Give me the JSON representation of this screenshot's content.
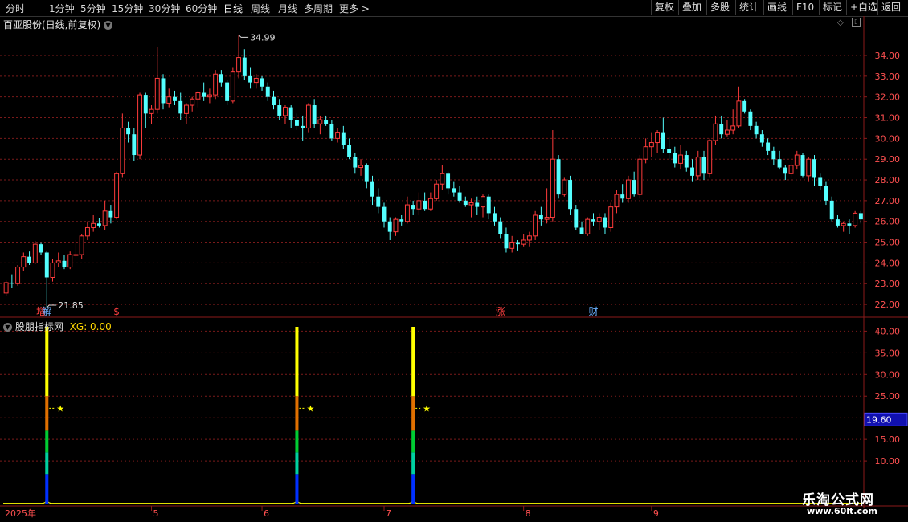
{
  "toolbar": {
    "periods": [
      "分时",
      "1分钟",
      "5分钟",
      "15分钟",
      "30分钟",
      "60分钟",
      "日线",
      "周线",
      "月线",
      "多周期",
      "更多"
    ],
    "active_period": "日线",
    "right_buttons": [
      "复权",
      "叠加",
      "多股",
      "统计",
      "画线",
      "F10",
      "标记",
      "+自选",
      "返回"
    ]
  },
  "main_panel": {
    "title": "百亚股份(日线,前复权)",
    "high_label": "34.99",
    "low_label": "21.85",
    "event_markers": [
      {
        "label": "增",
        "color": "#ff4040",
        "index": 6
      },
      {
        "label": "解",
        "color": "#6ab0ff",
        "index": 7
      },
      {
        "label": "$",
        "color": "#ff4040",
        "index": 19
      },
      {
        "label": "涨",
        "color": "#ff4040",
        "index": 85
      },
      {
        "label": "财",
        "color": "#6ab0ff",
        "index": 101
      }
    ],
    "y_ticks": [
      "34.00",
      "33.00",
      "32.00",
      "31.00",
      "30.00",
      "29.00",
      "28.00",
      "27.00",
      "26.00",
      "25.00",
      "24.00",
      "23.00",
      "22.00"
    ]
  },
  "indicator_panel": {
    "title": "股朋指标网",
    "value_label": "XG: 0.00",
    "y_ticks": [
      "40.00",
      "35.00",
      "30.00",
      "25.00",
      "20.00",
      "15.00",
      "10.00"
    ],
    "current_value": "19.60",
    "signal_symbol": "★"
  },
  "x_axis": {
    "labels": [
      {
        "text": "2025年",
        "index": 0
      },
      {
        "text": "5",
        "index": 25
      },
      {
        "text": "6",
        "index": 44
      },
      {
        "text": "7",
        "index": 65
      },
      {
        "text": "8",
        "index": 89
      },
      {
        "text": "9",
        "index": 111
      }
    ]
  },
  "watermark": {
    "title": "乐淘公式网",
    "url": "www.60lt.com"
  },
  "colors": {
    "up": "#ff3b3b",
    "down": "#54ffff",
    "grid": "#7a1a1a",
    "signal_yellow": "#ffff00",
    "signal_orange": "#e07000",
    "signal_green": "#00cc33",
    "signal_blue": "#0030ff"
  },
  "chart_data": {
    "type": "candlestick",
    "x": "trading days (2025年 Apr–Sep)",
    "ohlc": [
      [
        22.55,
        23.15,
        22.4,
        23.05
      ],
      [
        23.05,
        23.45,
        22.8,
        23.0
      ],
      [
        23.0,
        23.9,
        22.9,
        23.8
      ],
      [
        23.8,
        24.5,
        23.6,
        24.3
      ],
      [
        24.3,
        24.55,
        23.9,
        24.0
      ],
      [
        24.0,
        25.05,
        23.95,
        24.9
      ],
      [
        24.9,
        25.0,
        24.4,
        24.5
      ],
      [
        24.5,
        24.6,
        21.85,
        23.3
      ],
      [
        23.3,
        24.2,
        23.1,
        24.0
      ],
      [
        24.0,
        24.5,
        23.8,
        24.1
      ],
      [
        24.1,
        24.4,
        23.7,
        23.8
      ],
      [
        23.8,
        24.55,
        23.7,
        24.4
      ],
      [
        24.4,
        25.1,
        24.3,
        24.4
      ],
      [
        24.4,
        25.4,
        24.2,
        25.3
      ],
      [
        25.3,
        26.0,
        25.1,
        25.7
      ],
      [
        25.7,
        26.3,
        25.5,
        25.9
      ],
      [
        25.9,
        26.15,
        25.7,
        25.8
      ],
      [
        25.8,
        27.0,
        25.6,
        26.5
      ],
      [
        26.5,
        26.8,
        25.9,
        26.2
      ],
      [
        26.2,
        28.4,
        26.1,
        28.3
      ],
      [
        28.3,
        31.2,
        28.1,
        30.5
      ],
      [
        30.5,
        30.8,
        29.8,
        30.2
      ],
      [
        30.2,
        30.5,
        28.9,
        29.2
      ],
      [
        29.2,
        32.2,
        29.0,
        32.1
      ],
      [
        32.1,
        32.2,
        30.5,
        31.2
      ],
      [
        31.2,
        31.6,
        30.7,
        31.4
      ],
      [
        31.4,
        34.4,
        31.2,
        32.9
      ],
      [
        32.9,
        33.1,
        31.4,
        31.7
      ],
      [
        31.7,
        32.4,
        31.5,
        32.0
      ],
      [
        32.0,
        32.3,
        31.6,
        31.8
      ],
      [
        31.8,
        32.2,
        30.9,
        31.2
      ],
      [
        31.2,
        31.7,
        30.7,
        31.6
      ],
      [
        31.6,
        32.0,
        31.3,
        31.9
      ],
      [
        31.9,
        32.3,
        31.5,
        32.2
      ],
      [
        32.2,
        32.7,
        31.8,
        32.0
      ],
      [
        32.0,
        32.4,
        31.7,
        32.1
      ],
      [
        32.1,
        33.3,
        31.9,
        33.1
      ],
      [
        33.1,
        33.3,
        32.5,
        32.7
      ],
      [
        32.7,
        32.8,
        31.6,
        31.8
      ],
      [
        31.8,
        33.4,
        31.7,
        33.2
      ],
      [
        33.2,
        34.99,
        32.9,
        33.9
      ],
      [
        33.9,
        34.3,
        32.8,
        33.0
      ],
      [
        33.0,
        33.4,
        32.4,
        32.7
      ],
      [
        32.7,
        33.1,
        32.4,
        32.9
      ],
      [
        32.9,
        33.0,
        32.3,
        32.5
      ],
      [
        32.5,
        32.7,
        31.8,
        32.0
      ],
      [
        32.0,
        32.3,
        31.4,
        31.6
      ],
      [
        31.6,
        31.9,
        30.9,
        31.1
      ],
      [
        31.1,
        31.6,
        30.7,
        31.5
      ],
      [
        31.5,
        31.6,
        30.5,
        30.9
      ],
      [
        30.9,
        31.2,
        30.4,
        30.6
      ],
      [
        30.6,
        31.1,
        29.9,
        30.5
      ],
      [
        30.5,
        31.7,
        30.3,
        31.6
      ],
      [
        31.6,
        31.9,
        30.5,
        30.7
      ],
      [
        30.7,
        31.1,
        30.2,
        30.9
      ],
      [
        30.9,
        31.1,
        30.6,
        30.7
      ],
      [
        30.7,
        30.9,
        29.9,
        30.0
      ],
      [
        30.0,
        30.5,
        29.8,
        30.3
      ],
      [
        30.3,
        30.6,
        29.5,
        29.7
      ],
      [
        29.7,
        30.0,
        29.0,
        29.1
      ],
      [
        29.1,
        29.3,
        28.3,
        28.6
      ],
      [
        28.6,
        29.0,
        28.2,
        28.7
      ],
      [
        28.7,
        28.8,
        27.6,
        27.9
      ],
      [
        27.9,
        28.2,
        26.8,
        27.2
      ],
      [
        27.2,
        27.6,
        26.4,
        26.7
      ],
      [
        26.7,
        26.9,
        25.7,
        26.0
      ],
      [
        26.0,
        26.2,
        25.1,
        25.5
      ],
      [
        25.5,
        26.2,
        25.3,
        26.1
      ],
      [
        26.1,
        26.3,
        25.8,
        26.0
      ],
      [
        26.0,
        27.2,
        25.9,
        26.8
      ],
      [
        26.8,
        27.0,
        26.3,
        26.6
      ],
      [
        26.6,
        27.4,
        26.3,
        27.0
      ],
      [
        27.0,
        27.4,
        26.5,
        26.6
      ],
      [
        26.6,
        27.4,
        26.5,
        27.1
      ],
      [
        27.1,
        28.0,
        27.0,
        27.8
      ],
      [
        27.8,
        28.7,
        27.5,
        28.3
      ],
      [
        28.3,
        28.4,
        27.3,
        27.6
      ],
      [
        27.6,
        27.9,
        27.2,
        27.4
      ],
      [
        27.4,
        27.7,
        26.9,
        27.0
      ],
      [
        27.0,
        27.2,
        26.7,
        26.8
      ],
      [
        26.8,
        27.1,
        26.2,
        26.9
      ],
      [
        26.9,
        27.2,
        26.3,
        26.7
      ],
      [
        26.7,
        27.3,
        26.2,
        27.2
      ],
      [
        27.2,
        27.3,
        26.1,
        26.4
      ],
      [
        26.4,
        26.7,
        25.8,
        26.0
      ],
      [
        26.0,
        26.2,
        25.2,
        25.4
      ],
      [
        25.4,
        25.7,
        24.5,
        24.7
      ],
      [
        24.7,
        25.3,
        24.5,
        25.0
      ],
      [
        25.0,
        25.1,
        24.6,
        24.9
      ],
      [
        24.9,
        25.4,
        24.8,
        25.1
      ],
      [
        25.1,
        25.5,
        24.8,
        25.3
      ],
      [
        25.3,
        26.5,
        25.1,
        26.3
      ],
      [
        26.3,
        26.7,
        25.8,
        26.1
      ],
      [
        26.1,
        27.6,
        25.9,
        26.2
      ],
      [
        26.2,
        30.4,
        26.0,
        29.0
      ],
      [
        29.0,
        29.2,
        27.1,
        27.3
      ],
      [
        27.3,
        28.1,
        27.2,
        28.0
      ],
      [
        28.0,
        28.2,
        26.3,
        26.6
      ],
      [
        26.6,
        26.8,
        25.6,
        25.7
      ],
      [
        25.7,
        26.0,
        25.4,
        25.4
      ],
      [
        25.4,
        26.2,
        25.3,
        26.1
      ],
      [
        26.1,
        26.4,
        25.8,
        26.0
      ],
      [
        26.0,
        26.4,
        25.6,
        26.2
      ],
      [
        26.2,
        26.4,
        25.4,
        25.7
      ],
      [
        25.7,
        26.9,
        25.5,
        26.7
      ],
      [
        26.7,
        27.5,
        26.4,
        27.3
      ],
      [
        27.3,
        27.8,
        26.9,
        27.1
      ],
      [
        27.1,
        28.2,
        26.9,
        28.0
      ],
      [
        28.0,
        28.4,
        27.2,
        27.3
      ],
      [
        27.3,
        29.2,
        27.1,
        29.0
      ],
      [
        29.0,
        30.0,
        28.8,
        29.6
      ],
      [
        29.6,
        30.3,
        29.1,
        29.8
      ],
      [
        29.8,
        30.4,
        29.3,
        30.3
      ],
      [
        30.3,
        31.0,
        29.3,
        29.5
      ],
      [
        29.5,
        30.1,
        29.0,
        29.3
      ],
      [
        29.3,
        29.6,
        28.6,
        28.8
      ],
      [
        28.8,
        29.7,
        28.5,
        29.2
      ],
      [
        29.2,
        29.4,
        28.4,
        28.6
      ],
      [
        28.6,
        29.0,
        27.9,
        28.2
      ],
      [
        28.2,
        29.4,
        28.0,
        29.1
      ],
      [
        29.1,
        29.4,
        28.0,
        28.3
      ],
      [
        28.3,
        30.0,
        28.1,
        29.9
      ],
      [
        29.9,
        31.1,
        29.7,
        30.7
      ],
      [
        30.7,
        31.1,
        30.0,
        30.2
      ],
      [
        30.2,
        30.9,
        30.1,
        30.4
      ],
      [
        30.4,
        31.4,
        30.2,
        30.6
      ],
      [
        30.6,
        32.5,
        30.5,
        31.8
      ],
      [
        31.8,
        31.9,
        31.2,
        31.3
      ],
      [
        31.3,
        31.4,
        30.4,
        30.6
      ],
      [
        30.6,
        30.8,
        30.0,
        30.2
      ],
      [
        30.2,
        30.4,
        29.6,
        29.8
      ],
      [
        29.8,
        30.0,
        29.2,
        29.4
      ],
      [
        29.4,
        29.6,
        28.7,
        29.0
      ],
      [
        29.0,
        29.4,
        28.5,
        28.6
      ],
      [
        28.6,
        28.7,
        28.0,
        28.3
      ],
      [
        28.3,
        28.9,
        28.1,
        28.7
      ],
      [
        28.7,
        29.4,
        28.5,
        29.2
      ],
      [
        29.2,
        29.3,
        28.1,
        28.2
      ],
      [
        28.2,
        29.1,
        27.9,
        29.0
      ],
      [
        29.0,
        29.2,
        27.7,
        28.1
      ],
      [
        28.1,
        28.3,
        27.5,
        27.7
      ],
      [
        27.7,
        27.9,
        26.8,
        27.0
      ],
      [
        27.0,
        27.2,
        26.0,
        26.1
      ],
      [
        26.1,
        26.3,
        25.7,
        25.8
      ],
      [
        25.8,
        26.0,
        25.5,
        25.9
      ],
      [
        25.9,
        26.1,
        25.4,
        25.8
      ],
      [
        25.8,
        26.5,
        25.7,
        26.4
      ],
      [
        26.4,
        26.5,
        25.9,
        26.1
      ]
    ],
    "signal_indices": [
      7,
      50,
      70
    ],
    "indicator_value": 19.6,
    "main_ylim": [
      21.5,
      35.2
    ],
    "indicator_ylim": [
      0,
      41
    ],
    "grid": true
  }
}
